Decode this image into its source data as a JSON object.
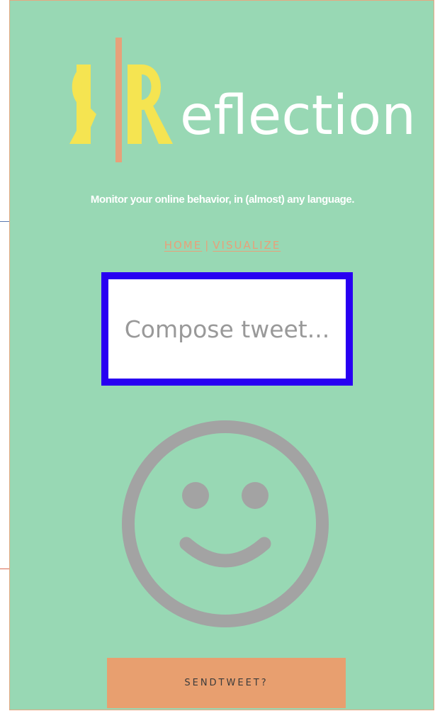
{
  "brand": {
    "name": "Reflection",
    "wordmark": "eflection",
    "colors": {
      "background": "#98d8b4",
      "accent": "#e7a17a",
      "logo_yellow": "#f5e451",
      "compose_border": "#2800f2",
      "smiley": "#a3a3a3"
    }
  },
  "header": {
    "tagline": "Monitor your online behavior, in (almost) any language."
  },
  "nav": {
    "home_label": "HOME",
    "separator": "|",
    "visualize_label": "VISUALIZE"
  },
  "compose": {
    "placeholder": "Compose tweet..."
  },
  "sentiment": {
    "icon": "smiley-face-icon"
  },
  "actions": {
    "send_label": "SENDTWEET?"
  }
}
